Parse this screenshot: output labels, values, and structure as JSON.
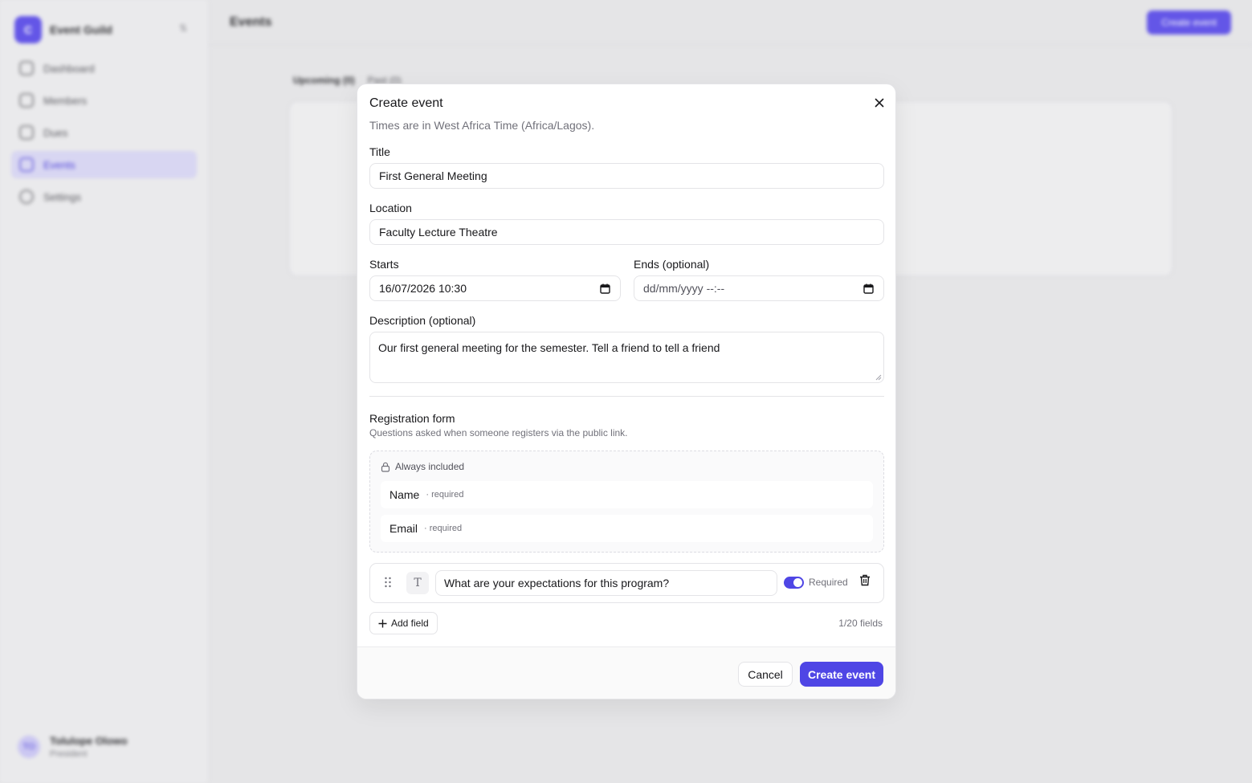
{
  "background": {
    "org": {
      "logo": "C",
      "name": "Event Guild"
    },
    "nav": [
      {
        "label": "Dashboard",
        "active": false
      },
      {
        "label": "Members",
        "active": false
      },
      {
        "label": "Dues",
        "active": false
      },
      {
        "label": "Events",
        "active": true
      },
      {
        "label": "Settings",
        "active": false
      }
    ],
    "user": {
      "initials": "TO",
      "name": "Tolulope Olowo",
      "role": "President"
    },
    "page_title": "Events",
    "top_button": "Create event",
    "tabs": [
      "Upcoming (0)",
      "Past (0)"
    ]
  },
  "dialog": {
    "title": "Create event",
    "subtitle": "Times are in West Africa Time (Africa/Lagos).",
    "fields": {
      "title_label": "Title",
      "title_value": "First General Meeting",
      "location_label": "Location",
      "location_value": "Faculty Lecture Theatre",
      "starts_label": "Starts",
      "starts_value": "16/07/2026 10:30",
      "ends_label": "Ends (optional)",
      "ends_placeholder": "dd/mm/yyyy --:--",
      "description_label": "Description (optional)",
      "description_value": "Our first general meeting for the semester. Tell a friend to tell a friend"
    },
    "registration": {
      "title": "Registration form",
      "subtitle": "Questions asked when someone registers via the public link.",
      "always_included_label": "Always included",
      "fixed_fields": [
        {
          "name": "Name",
          "note": "· required"
        },
        {
          "name": "Email",
          "note": "· required"
        }
      ],
      "custom_fields": [
        {
          "type_glyph": "T",
          "question": "What are your expectations for this program?",
          "required_label": "Required",
          "required": true
        }
      ],
      "add_field_label": "Add field",
      "field_count": "1/20 fields"
    },
    "actions": {
      "cancel": "Cancel",
      "create": "Create event"
    }
  },
  "colors": {
    "accent": "#4f46e5",
    "border": "#e4e4e7",
    "muted_text": "#71717a"
  }
}
